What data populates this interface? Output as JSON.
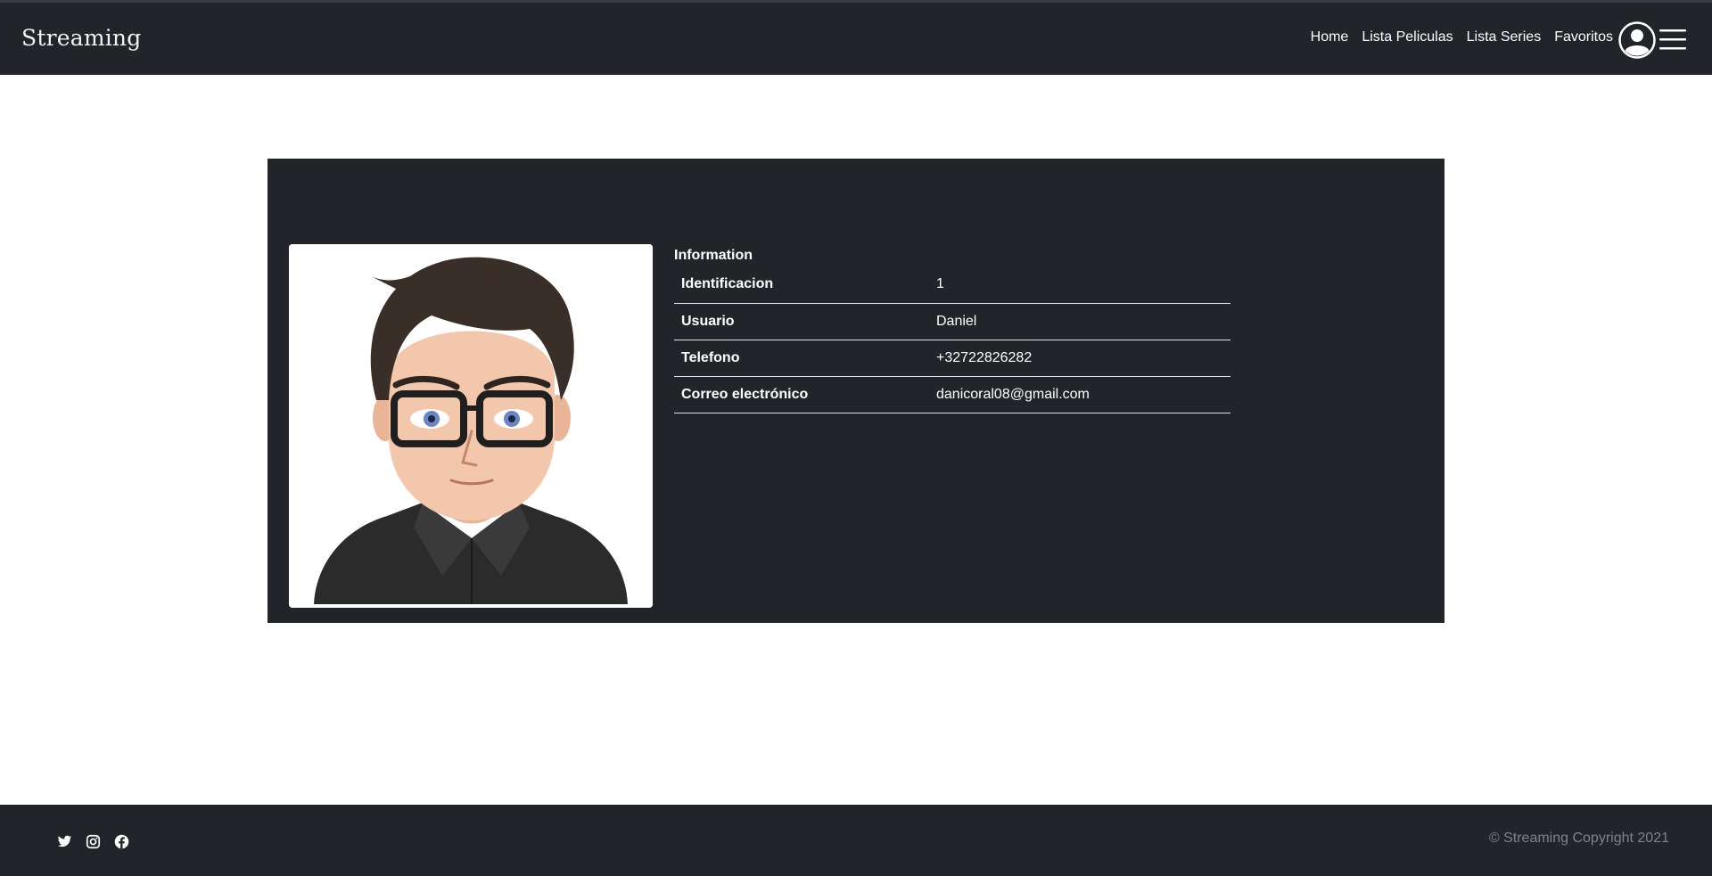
{
  "navbar": {
    "brand": "Streaming",
    "links": [
      "Home",
      "Lista Peliculas",
      "Lista Series",
      "Favoritos"
    ],
    "user_icon": "user-circle-icon",
    "menu_icon": "hamburger-menu-icon"
  },
  "profile": {
    "avatar": "cartoon-man-with-glasses-avatar",
    "info_title": "Information",
    "rows": [
      {
        "label": "Identificacion",
        "value": "1"
      },
      {
        "label": "Usuario",
        "value": "Daniel"
      },
      {
        "label": "Telefono",
        "value": "+32722826282"
      },
      {
        "label": "Correo electrónico",
        "value": "danicoral08@gmail.com"
      }
    ]
  },
  "footer": {
    "social_icons": [
      "twitter-icon",
      "instagram-icon",
      "facebook-icon"
    ],
    "copyright": "© Streaming Copyright 2021"
  },
  "colors": {
    "dark_bg": "#212529",
    "page_bg": "#ffffff",
    "muted_text": "#7f8387"
  }
}
